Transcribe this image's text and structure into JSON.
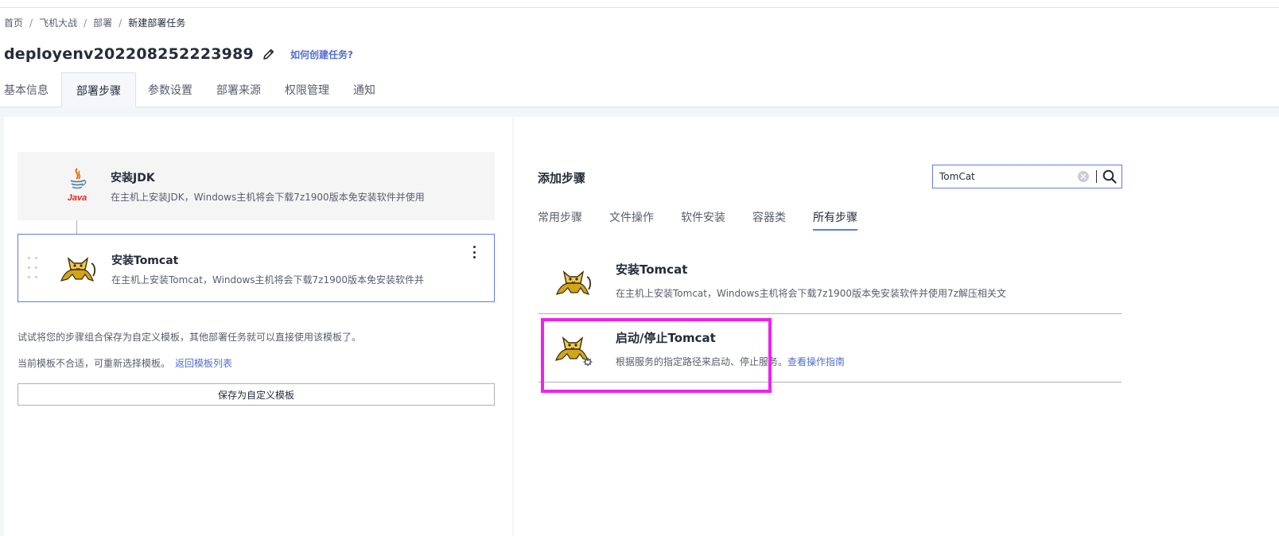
{
  "breadcrumb": {
    "items": [
      "首页",
      "飞机大战",
      "部署"
    ],
    "separator": "/",
    "current": "新建部署任务"
  },
  "header": {
    "title": "deployenv202208252223989",
    "help_link": "如何创建任务?"
  },
  "tabs": [
    {
      "label": "基本信息"
    },
    {
      "label": "部署步骤"
    },
    {
      "label": "参数设置"
    },
    {
      "label": "部署来源"
    },
    {
      "label": "权限管理"
    },
    {
      "label": "通知"
    }
  ],
  "active_tab": "部署步骤",
  "steps": [
    {
      "title": "安装JDK",
      "description": "在主机上安装JDK，Windows主机将会下载7z1900版本免安装软件并使用",
      "icon": "java-icon"
    },
    {
      "title": "安装Tomcat",
      "description": "在主机上安装Tomcat，Windows主机将会下载7z1900版本免安装软件并",
      "icon": "tomcat-icon"
    }
  ],
  "template": {
    "hint": "试试将您的步骤组合保存为自定义模板，其他部署任务就可以直接使用该模板了。",
    "hint2": "当前模板不合适，可重新选择模板。",
    "back_link": "返回模板列表",
    "save_button": "保存为自定义模板"
  },
  "add_step": {
    "title": "添加步骤",
    "search_value": "TomCat",
    "categories": [
      "常用步骤",
      "文件操作",
      "软件安装",
      "容器类",
      "所有步骤"
    ],
    "active_category": "所有步骤",
    "results": [
      {
        "title": "安装Tomcat",
        "description": "在主机上安装Tomcat，Windows主机将会下载7z1900版本免安装软件并使用7z解压相关文",
        "icon": "tomcat-icon"
      },
      {
        "title": "启动/停止Tomcat",
        "description": "根据服务的指定路径来启动、停止服务。",
        "link": "查看操作指南",
        "icon": "tomcat-gear-icon"
      }
    ]
  },
  "colors": {
    "accent": "#5e7ce0",
    "link": "#526ecc",
    "highlight": "#ee22ee",
    "background": "#f3f6f8"
  }
}
